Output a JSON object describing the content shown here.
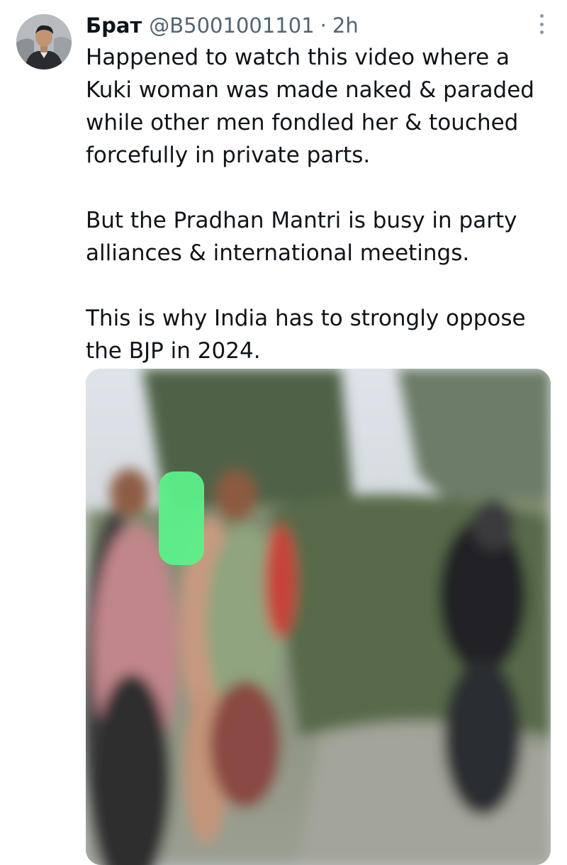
{
  "tweet": {
    "author": {
      "display_name": "Брат",
      "handle": "@B5001001101",
      "avatar_icon": "user-avatar-icon"
    },
    "separator": "·",
    "timestamp": "2h",
    "more_icon": "more-vertical-icon",
    "paragraphs": [
      "Happened to watch this video where a Kuki woman was made naked & paraded while other men fondled her & touched forcefully in private parts.",
      "But the Pradhan Mantri is busy in party alliances & international meetings.",
      "This is why India has to strongly oppose the BJP in 2024."
    ],
    "media": {
      "kind": "blurred-video-still",
      "censor_color": "#5cf08a"
    }
  }
}
